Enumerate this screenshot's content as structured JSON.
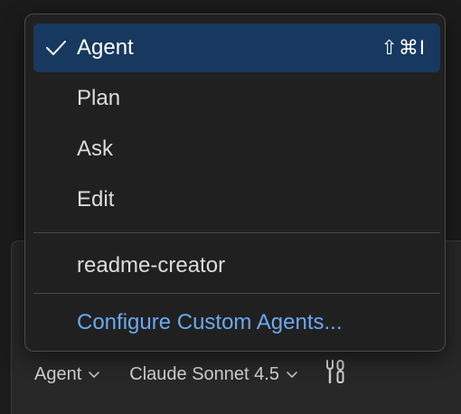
{
  "menu": {
    "items": [
      {
        "label": "Agent",
        "shortcut": "⇧⌘I",
        "checked": true
      },
      {
        "label": "Plan"
      },
      {
        "label": "Ask"
      },
      {
        "label": "Edit"
      }
    ],
    "custom_agents": [
      {
        "label": "readme-creator"
      }
    ],
    "configure_label": "Configure Custom Agents..."
  },
  "toolbar": {
    "mode_label": "Agent",
    "model_label": "Claude Sonnet 4.5",
    "tools_icon": "tools-icon"
  },
  "colors": {
    "active_bg": "#17395f",
    "link": "#6aa8ee",
    "menu_bg": "#202021",
    "page_bg": "#1b1b1c"
  }
}
